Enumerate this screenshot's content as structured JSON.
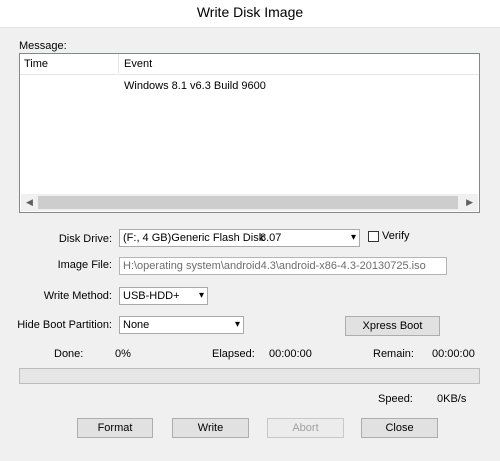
{
  "window": {
    "title": "Write Disk Image"
  },
  "message": {
    "label": "Message:",
    "columns": {
      "time": "Time",
      "event": "Event"
    },
    "rows": [
      {
        "time": "",
        "event": "Windows 8.1 v6.3 Build 9600"
      }
    ]
  },
  "disk_drive": {
    "label": "Disk Drive:",
    "value": "(F:, 4 GB)Generic Flash Disk",
    "version": "8.07"
  },
  "verify": {
    "label": "Verify",
    "checked": false
  },
  "image_file": {
    "label": "Image File:",
    "value": "H:\\operating system\\android4.3\\android-x86-4.3-20130725.iso"
  },
  "write_method": {
    "label": "Write Method:",
    "value": "USB-HDD+"
  },
  "hide_boot_partition": {
    "label": "Hide Boot Partition:",
    "value": "None"
  },
  "xpress_boot": {
    "label": "Xpress Boot"
  },
  "status": {
    "done_label": "Done:",
    "done_value": "0%",
    "elapsed_label": "Elapsed:",
    "elapsed_value": "00:00:00",
    "remain_label": "Remain:",
    "remain_value": "00:00:00",
    "speed_label": "Speed:",
    "speed_value": "0KB/s",
    "progress_fraction": 0
  },
  "buttons": {
    "format": "Format",
    "write": "Write",
    "abort": "Abort",
    "close": "Close"
  },
  "icons": {
    "dropdown": "chevron-down-icon",
    "scroll_left": "arrow-left-icon",
    "scroll_right": "arrow-right-icon"
  }
}
